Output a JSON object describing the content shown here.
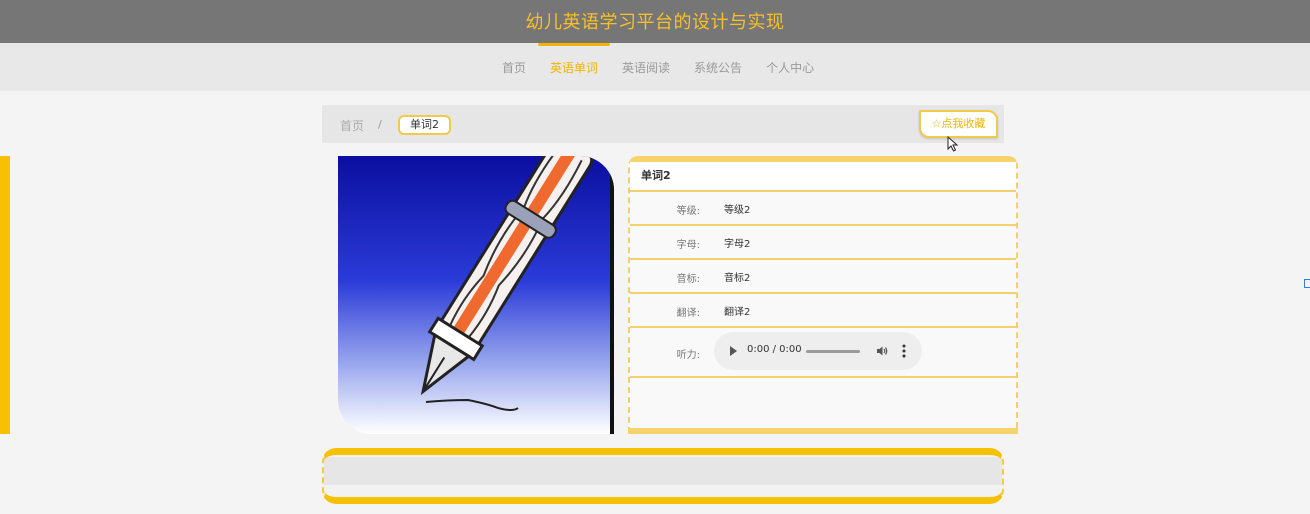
{
  "header": {
    "title": "幼儿英语学习平台的设计与实现"
  },
  "nav": {
    "items": [
      {
        "label": "首页",
        "active": false
      },
      {
        "label": "英语单词",
        "active": true
      },
      {
        "label": "英语阅读",
        "active": false
      },
      {
        "label": "系统公告",
        "active": false
      },
      {
        "label": "个人中心",
        "active": false
      }
    ]
  },
  "breadcrumb": {
    "home": "首页",
    "separator": "/",
    "current": "单词2"
  },
  "favorite_button": {
    "label": "☆点我收藏"
  },
  "word": {
    "title": "单词2",
    "rows": [
      {
        "label": "等级:",
        "value": "等级2"
      },
      {
        "label": "字母:",
        "value": "字母2"
      },
      {
        "label": "音标:",
        "value": "音标2"
      },
      {
        "label": "翻译:",
        "value": "翻译2"
      }
    ],
    "audio": {
      "label": "听力:",
      "time": "0:00 / 0:00"
    }
  },
  "colors": {
    "accent": "#f0b400",
    "header_bg": "#767676",
    "nav_bg": "#e8e8e8"
  },
  "icons": [
    "play-icon",
    "volume-icon",
    "more-vert-icon",
    "star-icon",
    "cursor-icon"
  ]
}
